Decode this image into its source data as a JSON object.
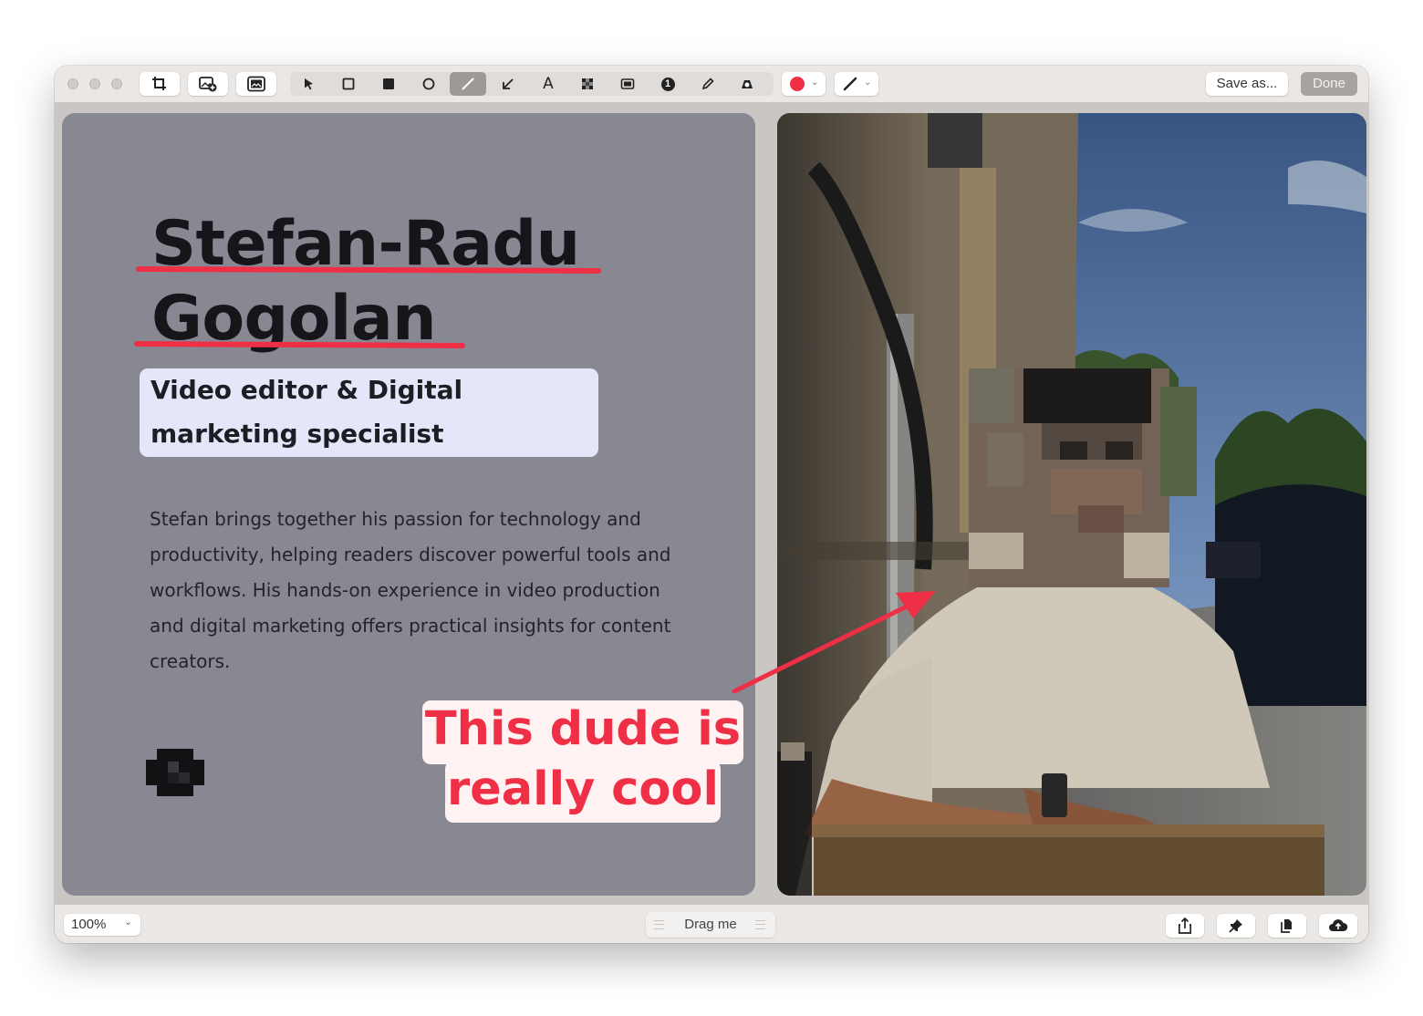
{
  "toolbar": {
    "traffic_lights": [
      "close",
      "minimize",
      "zoom"
    ],
    "left_buttons": [
      "crop-icon",
      "add-image-icon",
      "background-image-icon"
    ],
    "tools": [
      {
        "name": "select-tool",
        "icon": "cursor-arrow-icon"
      },
      {
        "name": "rectangle-tool",
        "icon": "rectangle-outline-icon"
      },
      {
        "name": "filled-rectangle-tool",
        "icon": "rectangle-filled-icon"
      },
      {
        "name": "ellipse-tool",
        "icon": "circle-outline-icon"
      },
      {
        "name": "line-tool",
        "icon": "line-icon",
        "active": true
      },
      {
        "name": "arrow-tool",
        "icon": "arrow-icon"
      },
      {
        "name": "text-tool",
        "icon": "text-icon",
        "label": "A"
      },
      {
        "name": "pixelate-tool",
        "icon": "pixelate-icon"
      },
      {
        "name": "highlight-tool",
        "icon": "highlight-box-icon"
      },
      {
        "name": "counter-tool",
        "icon": "counter-icon",
        "label": "1"
      },
      {
        "name": "pencil-tool",
        "icon": "pencil-icon"
      },
      {
        "name": "smart-tool",
        "icon": "smart-shape-icon"
      }
    ],
    "color_picker": {
      "color": "#ee2f45"
    },
    "stroke_picker": {
      "icon": "stroke-style-icon"
    },
    "save_label": "Save as...",
    "done_label": "Done"
  },
  "canvas": {
    "name_line1": "Stefan-Radu",
    "name_line2": "Gogolan",
    "subtitle": "Video editor & Digital marketing specialist",
    "bio": "Stefan brings together his passion for technology and productivity, helping readers discover powerful tools and workflows. His hands-on experience in video production and digital marketing offers practical insights for content creators.",
    "callout_line1": "This dude is",
    "callout_line2": "really cool",
    "annotation_color": "#ee2f45",
    "highlight_color": "#e6e6fa",
    "left_card_color": "#888893"
  },
  "bottom": {
    "zoom_label": "100%",
    "drag_label": "Drag me",
    "actions": [
      "share-icon",
      "pin-icon",
      "copy-icon",
      "cloud-upload-icon"
    ]
  }
}
